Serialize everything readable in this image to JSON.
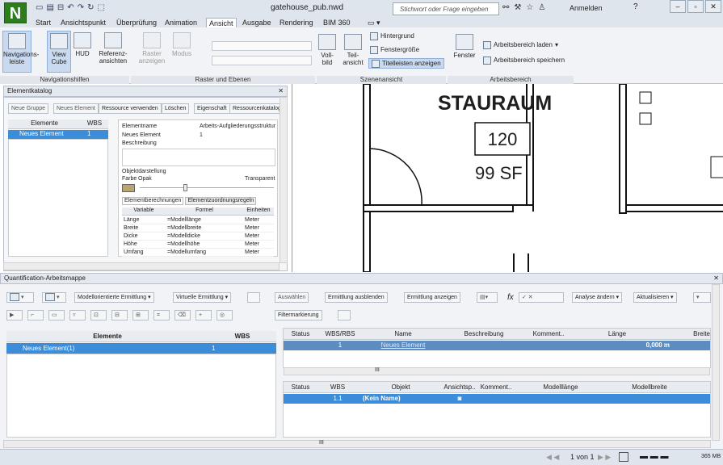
{
  "app": {
    "logo": "N",
    "title": "gatehouse_pub.nwd",
    "search_placeholder": "Stichwort oder Frage eingeben",
    "signin": "Anmelden",
    "help": "?"
  },
  "tabs": [
    "Start",
    "Ansichtspunkt",
    "Überprüfung",
    "Animation",
    "Ansicht",
    "Ausgabe",
    "Rendering",
    "BIM 360"
  ],
  "active_tab": "Ansicht",
  "ribbon": {
    "nav_buttons": [
      "Navigations-\nleiste",
      "View\nCube",
      "HUD",
      "Referenz-\nansichten"
    ],
    "raster_buttons": [
      "Raster\nanzeigen",
      "Modus"
    ],
    "scene_buttons": [
      "Voll-\nbild",
      "Teil-\nansicht"
    ],
    "scene_small": [
      "Hintergrund",
      "Fenstergröße",
      "Titelleisten anzeigen"
    ],
    "window_button": "Fenster",
    "workspace": [
      "Arbeitsbereich laden",
      "Arbeitsbereich speichern"
    ],
    "groups": [
      "Navigationshilfen",
      "Raster und Ebenen",
      "Szenenansicht",
      "Arbeitsbereich"
    ]
  },
  "catalog": {
    "title": "Elementkatalog",
    "toolbar": [
      "Neue Gruppe",
      "Neues Element",
      "Ressource verwenden",
      "Löschen",
      "Eigenschaft",
      "Ressourcenkatalog"
    ],
    "tree_headers": [
      "Elemente",
      "WBS"
    ],
    "tree_row": {
      "name": "Neues Element",
      "wbs": "1"
    },
    "props": {
      "name_label": "Elementname",
      "wbs_label": "Arbeits-Aufgliederungsstruktur",
      "name_value": "Neues Element",
      "wbs_value": "1",
      "desc_label": "Beschreibung",
      "appearance": "Objektdarstellung",
      "color": "Farbe",
      "opaque": "Opak",
      "transparent": "Transparent"
    },
    "subtabs": [
      "Elementberechnungen",
      "Elementzuordnungsregeln"
    ],
    "calc_headers": [
      "Variable",
      "Formel",
      "Einheiten"
    ],
    "calc_rows": [
      [
        "Länge",
        "=Modelllänge",
        "Meter"
      ],
      [
        "Breite",
        "=Modellbreite",
        "Meter"
      ],
      [
        "Dicke",
        "=Modelldicke",
        "Meter"
      ],
      [
        "Höhe",
        "=Modellhöhe",
        "Meter"
      ],
      [
        "Umfang",
        "=Modellumfang",
        "Meter"
      ]
    ]
  },
  "canvas": {
    "room_name": "STAURAUM",
    "room_number": "120",
    "area": "99 SF"
  },
  "workbook": {
    "title": "Quantification-Arbeitsmappe",
    "toolbar": [
      "Modellorientierte Ermittlung",
      "Virtuelle Ermittlung",
      "Auswählen",
      "Ermittlung ausblenden",
      "Ermittlung anzeigen",
      "Analyse ändern",
      "Aktualisieren",
      "Filtermarkierung"
    ],
    "tree_headers": [
      "Elemente",
      "WBS"
    ],
    "tree_row": {
      "name": "Neues Element(1)",
      "wbs": "1"
    },
    "top_headers": [
      "Status",
      "WBS/RBS",
      "Name",
      "Beschreibung",
      "Komment..",
      "Länge",
      "Breite"
    ],
    "top_row": {
      "wbs": "1",
      "name": "Neues Element",
      "length": "0,000 m"
    },
    "bottom_headers": [
      "Status",
      "WBS",
      "Objekt",
      "Ansichtsp..",
      "Komment..",
      "Modelllänge",
      "Modellbreite"
    ],
    "bottom_row": {
      "wbs": "1.1",
      "object": "(Kein Name)"
    },
    "scroll_mark": "III"
  },
  "statusbar": {
    "page": "1 von 1",
    "memory": "365 MB"
  }
}
